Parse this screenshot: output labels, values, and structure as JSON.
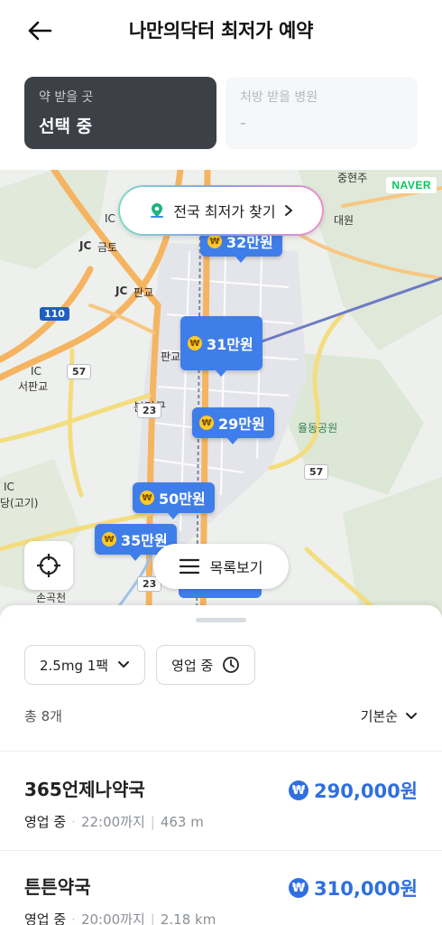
{
  "header": {
    "title": "나만의닥터 최저가 예약"
  },
  "selectors": {
    "pickup": {
      "label": "약 받을 곳",
      "value": "선택 중"
    },
    "hospital": {
      "label": "처방 받을 병원",
      "value": "-"
    }
  },
  "map": {
    "provider": "NAVER",
    "search_nationwide": "전국 최저가 찾기",
    "list_view": "목록보기",
    "labels": {
      "geumto": "금토",
      "pangyo": "판교",
      "pangyo2": "판교",
      "seopangyo": "서판교",
      "bundanggu": "분당구",
      "yuldong": "율동공원",
      "songok": "손곡천",
      "daewon": "대원",
      "junghyeon": "중현주",
      "dang_gogi": "당(고기)",
      "ic1": "IC",
      "jc1": "JC",
      "jc2": "JC",
      "ic2": "IC",
      "ic3": "IC"
    },
    "roads": {
      "r110": "110",
      "r57a": "57",
      "r57b": "57",
      "r23a": "23",
      "r23b": "23"
    },
    "pins": [
      {
        "price": "32만원"
      },
      {
        "price": "31만원"
      },
      {
        "price": "29만원"
      },
      {
        "price": "50만원"
      },
      {
        "price": "35만원"
      }
    ]
  },
  "filters": {
    "dosage": "2.5mg 1팩",
    "open_now": "영업 중"
  },
  "summary": {
    "count": "총 8개",
    "sort": "기본순"
  },
  "pharmacies": [
    {
      "name": "365언제나약국",
      "status": "영업 중",
      "hours": "22:00까지",
      "distance": "463 m",
      "price": "290,000원"
    },
    {
      "name": "튼튼약국",
      "status": "영업 중",
      "hours": "20:00까지",
      "distance": "2.18 km",
      "price": "310,000원"
    }
  ]
}
